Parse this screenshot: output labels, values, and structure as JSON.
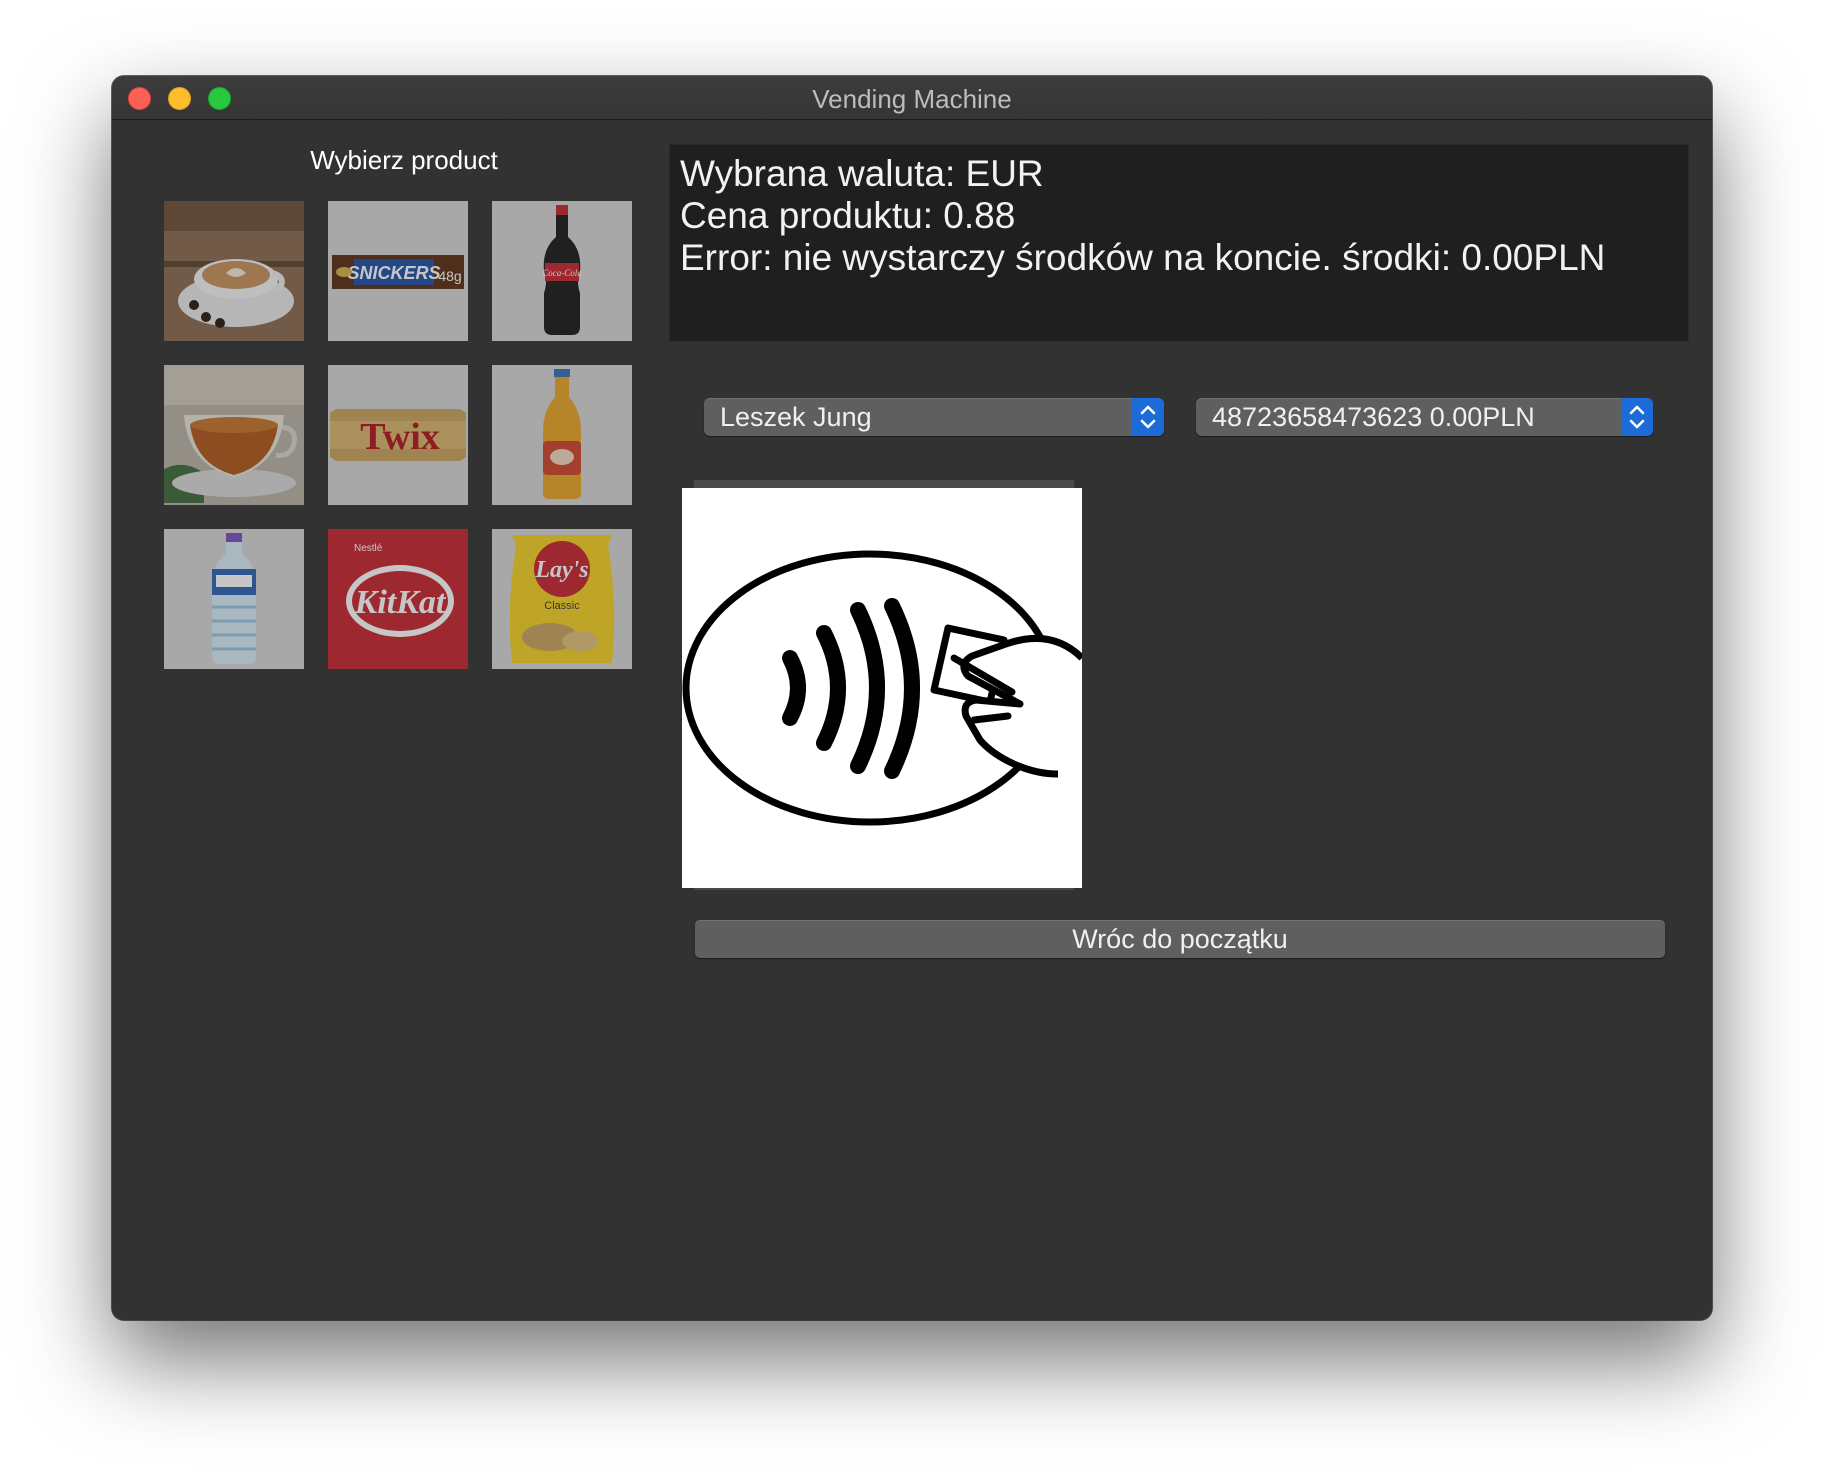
{
  "window": {
    "title": "Vending Machine"
  },
  "products": {
    "heading": "Wybierz product",
    "items": [
      {
        "icon": "coffee-cup-icon"
      },
      {
        "icon": "snickers-bar-icon",
        "label": "SNICKERS",
        "weight": "48g"
      },
      {
        "icon": "cola-bottle-icon",
        "label": "Coca-Cola"
      },
      {
        "icon": "tea-cup-icon"
      },
      {
        "icon": "twix-bar-icon",
        "label": "Twix"
      },
      {
        "icon": "juice-bottle-icon"
      },
      {
        "icon": "water-bottle-icon"
      },
      {
        "icon": "kitkat-bar-icon",
        "label": "KitKat",
        "brand": "Nestlé"
      },
      {
        "icon": "lays-chips-icon",
        "label": "Lay's",
        "variant": "Classic"
      }
    ]
  },
  "status": {
    "currency_line": "Wybrana waluta: EUR",
    "price_line": "Cena produktu: 0.88",
    "error_line": "Error: nie wystarczy środków na koncie. środki: 0.00PLN"
  },
  "payment": {
    "user_select_value": "Leszek Jung",
    "account_select_value": "48723658473623 0.00PLN",
    "nfc_icon": "contactless-payment-icon"
  },
  "actions": {
    "back_label": "Wróc do początku"
  },
  "colors": {
    "window_bg": "#323232",
    "status_bg": "#1f1f1f",
    "select_accent": "#1c6bd8",
    "kitkat_red": "#c8242f",
    "lays_yellow": "#f5d223"
  }
}
